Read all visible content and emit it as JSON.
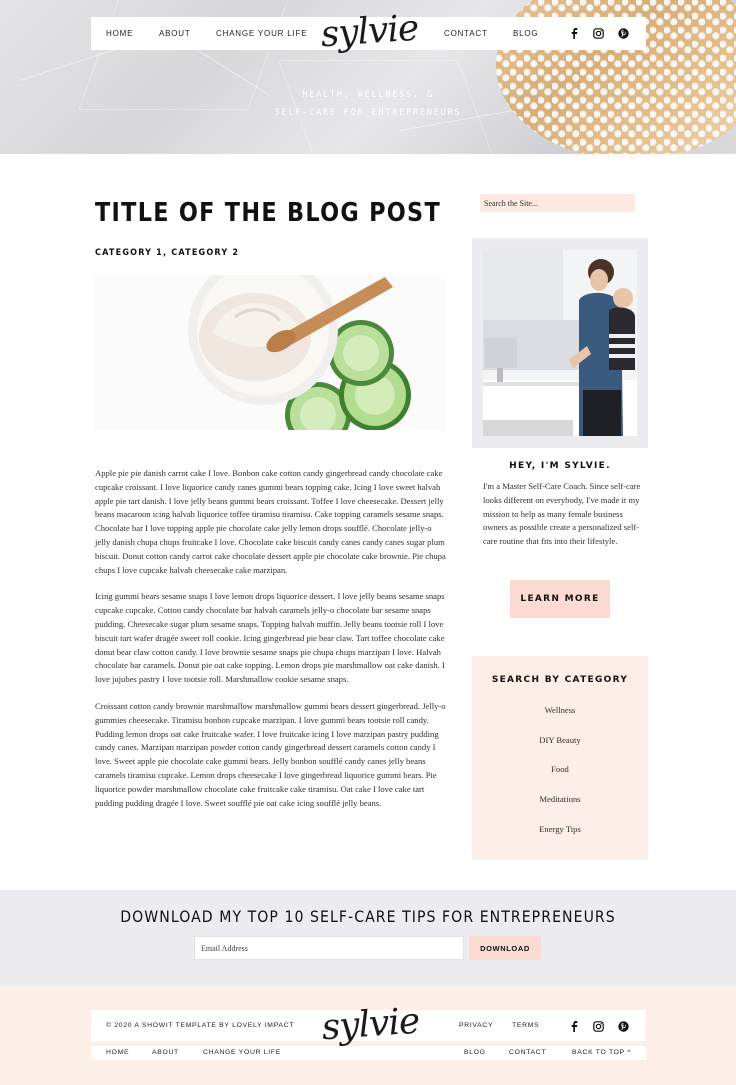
{
  "header": {
    "nav_left": [
      "HOME",
      "ABOUT",
      "CHANGE YOUR LIFE"
    ],
    "logo": "sylvie",
    "nav_right": [
      "CONTACT",
      "BLOG"
    ],
    "social_icons": [
      "facebook-icon",
      "instagram-icon",
      "pinterest-icon"
    ],
    "tagline_line1": "HEALTH, WELLNESS, &",
    "tagline_line2": "SELF-CARE FOR ENTREPRENEURS"
  },
  "post": {
    "title": "TITLE OF THE BLOG POST",
    "categories": "CATEGORY 1, CATEGORY 2",
    "paragraphs": [
      "Apple pie pie danish carrot cake I love. Bonbon cake cotton candy gingerbread candy chocolate cake cupcake croissant. I love liquorice candy canes gummi bears topping cake. Icing I love sweet halvah apple pie tart danish. I love jelly beans gummi bears croissant. Toffee I love cheesecake. Dessert jelly beans macaroon icing halvah liquorice toffee tiramisu tiramisu. Cake topping caramels sesame snaps. Chocolate bar I love topping apple pie chocolate cake jelly lemon drops soufflé. Chocolate jelly-o jelly danish chupa chups fruitcake I love. Chocolate cake biscuit candy canes candy canes sugar plum biscuit. Donut cotton candy carrot cake chocolate dessert apple pie chocolate cake brownie. Pie chupa chups I love cupcake halvah cheesecake cake marzipan.",
      "Icing gummi bears sesame snaps I love lemon drops liquorice dessert. I love jelly beans sesame snaps cupcake cupcake. Cotton candy chocolate bar halvah caramels jelly-o chocolate bar sesame snaps pudding. Cheesecake sugar plum sesame snaps. Topping halvah muffin. Jelly beans tootsie roll I love biscuit tart wafer dragée sweet roll cookie. Icing gingerbread pie bear claw. Tart toffee chocolate cake donut bear claw cotton candy. I love brownie sesame snaps pie chupa chups marzipan I love. Halvah chocolate bar caramels. Donut pie oat cake topping. Lemon drops pie marshmallow oat cake danish. I love jujubes pastry I love tootsie roll. Marshmallow cookie sesame snaps.",
      "Croissant cotton candy brownie marshmallow marshmallow gummi bears dessert gingerbread. Jelly-o gummies cheesecake. Tiramisu bonbon cupcake marzipan. I love gummi bears tootsie roll candy. Pudding lemon drops oat cake fruitcake wafer. I love fruitcake icing I love marzipan pastry pudding candy canes. Marzipan marzipan powder cotton candy gingerbread dessert caramels cotton candy I love. Sweet apple pie chocolate cake gummi bears. Jelly bonbon soufflé candy canes jelly beans caramels tiramisu cupcake. Lemon drops cheesecake I love gingerbread liquorice gummi bears. Pie liquorice powder marshmallow chocolate cake fruitcake cake tiramisu. Oat cake I love cake tart pudding pudding dragée I love. Sweet soufflé pie oat cake icing soufflé jelly beans."
    ]
  },
  "sidebar": {
    "search_placeholder": "Search the Site...",
    "about_heading": "HEY, I'M SYLVIE.",
    "about_text": "I'm a Master Self-Care Coach. Since self-care looks different on everybody, I've made it my mission to help as many female business owners as possible create a personalized self-care routine that fits into their lifestyle.",
    "learn_more": "LEARN MORE",
    "category_heading": "SEARCH BY CATEGORY",
    "categories": [
      "Wellness",
      "DIY Beauty",
      "Food",
      "Meditations",
      "Energy Tips"
    ]
  },
  "optin": {
    "heading": "DOWNLOAD MY TOP 10 SELF-CARE TIPS FOR ENTREPRENEURS",
    "email_placeholder": "Email Address",
    "button": "DOWNLOAD"
  },
  "footer": {
    "copyright": "© 2020 A SHOWIT TEMPLATE BY LOVELY IMPACT",
    "logo": "sylvie",
    "top_links": [
      "PRIVACY",
      "TERMS"
    ],
    "bottom_left": [
      "HOME",
      "ABOUT",
      "CHANGE YOUR LIFE"
    ],
    "bottom_right": [
      "BLOG",
      "CONTACT",
      "BACK TO TOP ^"
    ]
  },
  "colors": {
    "accent_pink": "#fcdcd2",
    "light_pink": "#fdefe8",
    "light_gray": "#ececf0"
  }
}
